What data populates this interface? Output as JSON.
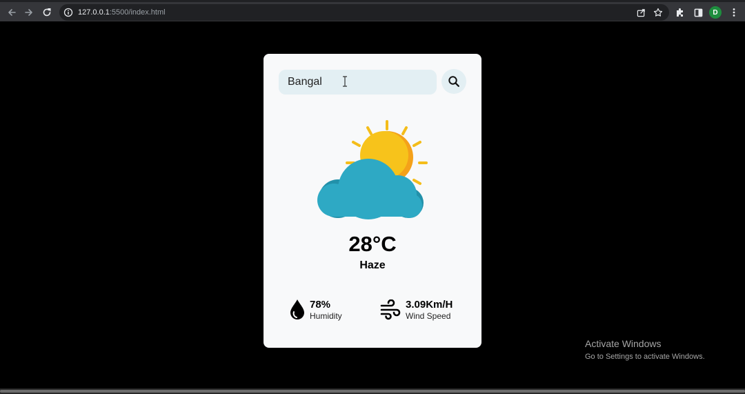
{
  "browser": {
    "url_host": "127.0.0.1",
    "url_path": ":5500/index.html",
    "profile_initial": "D",
    "profile_color": "#1e8e3e"
  },
  "search": {
    "value": "Bangal",
    "icon": "search-icon"
  },
  "weather": {
    "icon": "sun-behind-cloud-icon",
    "temperature": "28°C",
    "condition": "Haze",
    "humidity": {
      "value": "78%",
      "label": "Humidity",
      "icon": "water-drop-icon"
    },
    "wind": {
      "value": "3.09Km/H",
      "label": "Wind Speed",
      "icon": "wind-icon"
    }
  },
  "watermark": {
    "title": "Activate Windows",
    "subtitle": "Go to Settings to activate Windows."
  },
  "colors": {
    "card_bg": "#f8f9fa",
    "search_bg": "#e3eff3",
    "sun": "#f7c31b",
    "cloud": "#2ea9c4"
  }
}
